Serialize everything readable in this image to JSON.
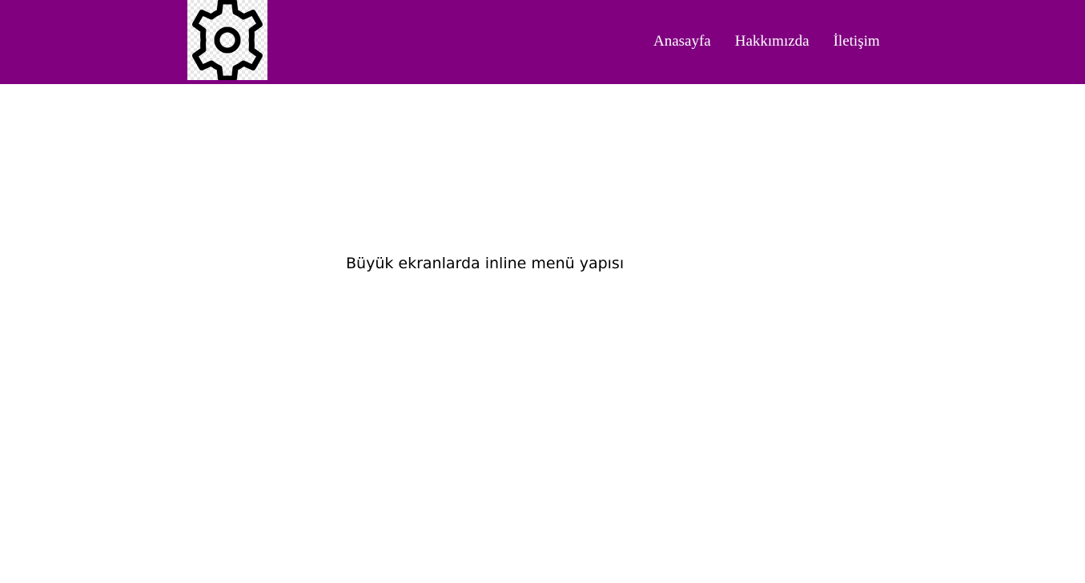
{
  "header": {
    "background_color": "#800080",
    "logo_icon": "gear-icon"
  },
  "nav": {
    "items": [
      {
        "label": "Anasayfa"
      },
      {
        "label": "Hakkımızda"
      },
      {
        "label": "İletişim"
      }
    ],
    "text_color": "#ffffff"
  },
  "main": {
    "text": "Büyük ekranlarda inline menü yapısı"
  }
}
